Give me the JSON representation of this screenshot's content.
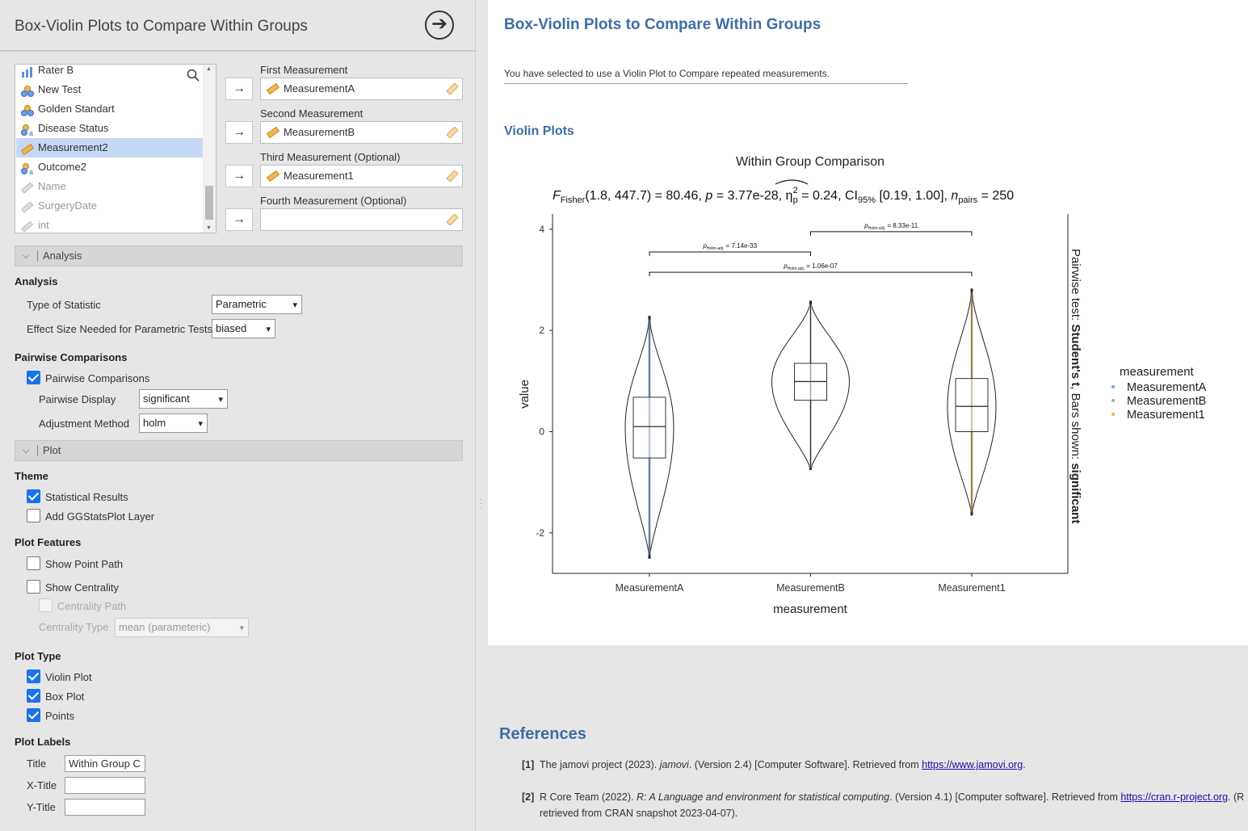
{
  "panel": {
    "title": "Box-Violin Plots to Compare Within Groups",
    "go_icon": "arrow-right-circle-icon"
  },
  "variables": [
    {
      "label": "Rater B",
      "icon": "continuous-bar-icon",
      "dim": false
    },
    {
      "label": "New Test",
      "icon": "nominal-icon",
      "dim": false
    },
    {
      "label": "Golden Standart",
      "icon": "nominal-icon",
      "dim": false
    },
    {
      "label": "Disease Status",
      "icon": "nominal-text-icon",
      "dim": false
    },
    {
      "label": "Measurement2",
      "icon": "ruler-icon",
      "dim": false,
      "selected": true
    },
    {
      "label": "Outcome2",
      "icon": "nominal-text-icon",
      "dim": false
    },
    {
      "label": "Name",
      "icon": "id-icon",
      "dim": true
    },
    {
      "label": "SurgeryDate",
      "icon": "id-icon",
      "dim": true
    },
    {
      "label": "int",
      "icon": "id-icon",
      "dim": true
    }
  ],
  "slots": [
    {
      "label": "First Measurement",
      "value": "MeasurementA"
    },
    {
      "label": "Second Measurement",
      "value": "MeasurementB"
    },
    {
      "label": "Third Measurement (Optional)",
      "value": "Measurement1"
    },
    {
      "label": "Fourth Measurement (Optional)",
      "value": ""
    }
  ],
  "analysis_section": {
    "bar": "Analysis",
    "group": "Analysis",
    "type_label": "Type of Statistic",
    "type_value": "Parametric",
    "effect_label": "Effect Size Needed for Parametric Tests",
    "effect_value": "biased"
  },
  "pairwise": {
    "group": "Pairwise Comparisons",
    "checkbox": "Pairwise Comparisons",
    "display_label": "Pairwise Display",
    "display_value": "significant",
    "adjust_label": "Adjustment Method",
    "adjust_value": "holm"
  },
  "plot_section": {
    "bar": "Plot",
    "theme_group": "Theme",
    "statistical_results": "Statistical Results",
    "add_layer": "Add GGStatsPlot Layer",
    "features_group": "Plot Features",
    "show_point_path": "Show Point Path",
    "show_centrality": "Show Centrality",
    "centrality_path": "Centrality Path",
    "centrality_type_label": "Centrality Type",
    "centrality_type_value": "mean (parameteric)",
    "type_group": "Plot Type",
    "violin": "Violin Plot",
    "box": "Box Plot",
    "points": "Points",
    "labels_group": "Plot Labels",
    "title_label": "Title",
    "title_value": "Within Group C",
    "xtitle_label": "X-Title",
    "xtitle_value": "",
    "ytitle_label": "Y-Title",
    "ytitle_value": ""
  },
  "results": {
    "title": "Box-Violin Plots to Compare Within Groups",
    "note": "You have selected to use a Violin Plot to Compare repeated measurements.",
    "violin_heading": "Violin Plots"
  },
  "chart_data": {
    "type": "violin",
    "title": "Within Group Comparison",
    "subtitle_parts": {
      "F": "F",
      "F_sub": "Fisher",
      "df": "(1.8, 447.7) = 80.46, ",
      "p": "p",
      "p_val": " = 3.77e-28, ",
      "eta": "η",
      "eta_sup": "2",
      "eta_sub": "p",
      "eta_val": " = 0.24, CI",
      "ci_sub": "95%",
      "ci_val": " [0.19, 1.00], ",
      "n": "n",
      "n_sub": "pairs",
      "n_val": " = 250"
    },
    "xlabel": "measurement",
    "ylabel": "value",
    "categories": [
      "MeasurementA",
      "MeasurementB",
      "Measurement1"
    ],
    "ylim": [
      -2.8,
      4.3
    ],
    "yticks": [
      -2,
      0,
      2,
      4
    ],
    "series": [
      {
        "name": "MeasurementA",
        "color": "#6fa6e8",
        "min": -2.5,
        "q1": -0.52,
        "median": 0.1,
        "q3": 0.68,
        "max": 2.28,
        "violin_peak": 0.1
      },
      {
        "name": "MeasurementB",
        "color": "#aaaaaa",
        "min": -0.75,
        "q1": 0.62,
        "median": 0.99,
        "q3": 1.35,
        "max": 2.58,
        "violin_peak": 1.0
      },
      {
        "name": "Measurement1",
        "color": "#e8b050",
        "min": -1.65,
        "q1": 0.0,
        "median": 0.5,
        "q3": 1.05,
        "max": 2.82,
        "violin_peak": 0.5
      }
    ],
    "pairwise": [
      {
        "from": 0,
        "to": 1,
        "y": 3.55,
        "label_p": "p",
        "label_sub": "Holm-adj.",
        "label_val": " = 7.14e-33"
      },
      {
        "from": 0,
        "to": 2,
        "y": 3.15,
        "label_p": "p",
        "label_sub": "Holm-adj.",
        "label_val": " = 1.06e-07"
      },
      {
        "from": 1,
        "to": 2,
        "y": 3.95,
        "label_p": "p",
        "label_sub": "Holm-adj.",
        "label_val": " = 8.33e-11"
      }
    ],
    "caption_prefix": "Pairwise test: ",
    "caption_test": "Student's t",
    "caption_mid": ", Bars shown: ",
    "caption_bars": "significant",
    "legend_title": "measurement",
    "legend_position": "right"
  },
  "references": {
    "heading": "References",
    "items": [
      {
        "num": "[1]",
        "pre": "The jamovi project (2023). ",
        "italic": "jamovi",
        "post": ". (Version 2.4) [Computer Software]. Retrieved from ",
        "link": "https://www.jamovi.org",
        "tail": ".",
        "line2": ""
      },
      {
        "num": "[2]",
        "pre": "R Core Team (2022). ",
        "italic": "R: A Language and environment for statistical computing",
        "post": ". (Version 4.1) [Computer software]. Retrieved from ",
        "link": "https://cran.r-project.org",
        "tail": ". (R",
        "line2": "retrieved from CRAN snapshot 2023-04-07)."
      }
    ]
  }
}
